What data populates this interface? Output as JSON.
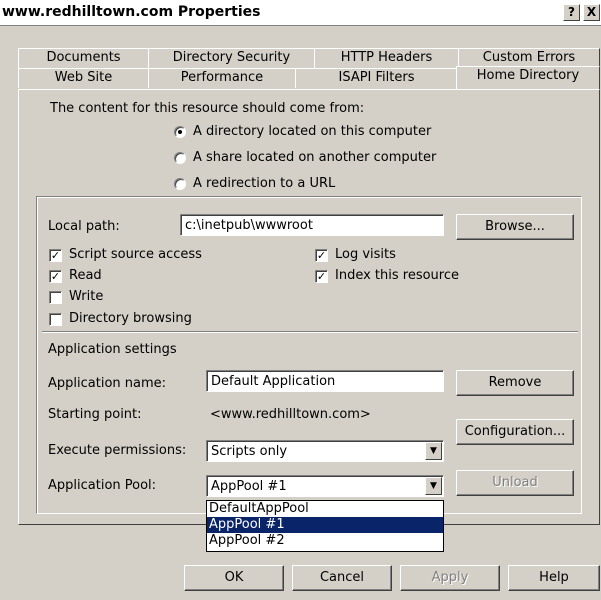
{
  "window": {
    "title": "www.redhilltown.com Properties",
    "help_glyph": "?",
    "close_glyph": "X"
  },
  "tabs_row1": [
    "Documents",
    "Directory Security",
    "HTTP Headers",
    "Custom Errors"
  ],
  "tabs_row2": [
    "Web Site",
    "Performance",
    "ISAPI Filters",
    "Home Directory"
  ],
  "active_tab": "Home Directory",
  "content_source": {
    "heading": "The content for this resource should come from:",
    "options": [
      {
        "label": "A directory located on this computer",
        "selected": true
      },
      {
        "label": "A share located on another computer",
        "selected": false
      },
      {
        "label": "A redirection to a URL",
        "selected": false
      }
    ]
  },
  "local_path": {
    "label": "Local path:",
    "value": "c:\\inetpub\\wwwroot",
    "browse_label": "Browse..."
  },
  "checks": {
    "script_source_access": {
      "label": "Script source access",
      "checked": true
    },
    "read": {
      "label": "Read",
      "checked": true
    },
    "write": {
      "label": "Write",
      "checked": false
    },
    "directory_browsing": {
      "label": "Directory browsing",
      "checked": false
    },
    "log_visits": {
      "label": "Log visits",
      "checked": true
    },
    "index_resource": {
      "label": "Index this resource",
      "checked": true
    }
  },
  "app_settings": {
    "heading": "Application settings",
    "name_label": "Application name:",
    "name_value": "Default Application",
    "remove_label": "Remove",
    "starting_point_label": "Starting point:",
    "starting_point_value": "<www.redhilltown.com>",
    "configuration_label": "Configuration...",
    "exec_label": "Execute permissions:",
    "exec_value": "Scripts only",
    "pool_label": "Application Pool:",
    "pool_value": "AppPool #1",
    "unload_label": "Unload",
    "pool_options": [
      "DefaultAppPool",
      "AppPool #1",
      "AppPool #2"
    ],
    "pool_selected_index": 1
  },
  "footer": {
    "ok": "OK",
    "cancel": "Cancel",
    "apply": "Apply",
    "help": "Help"
  }
}
